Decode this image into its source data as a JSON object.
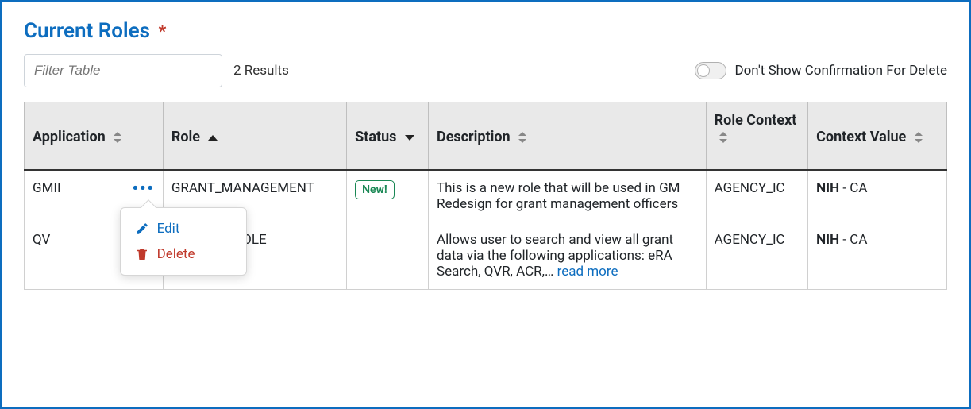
{
  "title": "Current Roles",
  "required_marker": "*",
  "filter": {
    "placeholder": "Filter Table"
  },
  "results_label": "2 Results",
  "toggle_label": "Don't Show Confirmation For Delete",
  "columns": {
    "application": "Application",
    "role": "Role",
    "status": "Status",
    "description": "Description",
    "role_context": "Role Context",
    "context_value": "Context Value"
  },
  "menu": {
    "edit": "Edit",
    "delete": "Delete"
  },
  "badges": {
    "new": "New!"
  },
  "read_more": "read more",
  "rows": [
    {
      "application": "GMII",
      "role": "GRANT_MANAGEMENT",
      "status_new": true,
      "description": "This is a new role that will be used in GM Redesign for grant management officers",
      "role_context": "AGENCY_IC",
      "context_value_bold": "NIH",
      "context_value_rest": " - CA",
      "has_menu_open": true,
      "read_more": false
    },
    {
      "application": "QV",
      "role": "QV_USER_ROLE",
      "status_new": false,
      "description": "Allows user to search and view all grant data via the following applications: eRA Search, QVR, ACR,… ",
      "role_context": "AGENCY_IC",
      "context_value_bold": "NIH",
      "context_value_rest": " - CA",
      "has_menu_open": false,
      "read_more": true
    }
  ]
}
